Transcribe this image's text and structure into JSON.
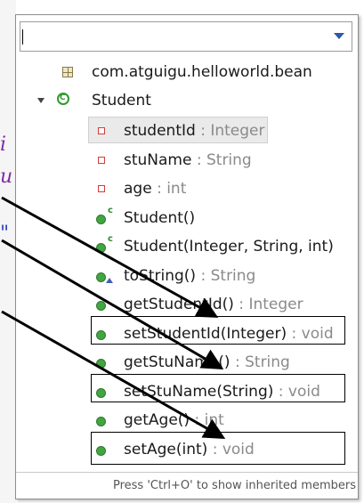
{
  "editor": {
    "fragments": [
      "i",
      "u",
      "\""
    ]
  },
  "outline": {
    "filter_value": "",
    "package": "com.atguigu.helloworld.bean",
    "class_name": "Student",
    "members": [
      {
        "name": "studentId",
        "type": " : Integer",
        "kind": "private-field",
        "selected": true
      },
      {
        "name": "stuName",
        "type": " : String",
        "kind": "private-field"
      },
      {
        "name": "age",
        "type": " : int",
        "kind": "private-field"
      },
      {
        "name": "Student()",
        "type": "",
        "kind": "constructor"
      },
      {
        "name": "Student(Integer, String, int)",
        "type": "",
        "kind": "constructor"
      },
      {
        "name": "toString()",
        "type": " : String",
        "kind": "override-method"
      },
      {
        "name": "getStudentId()",
        "type": " : Integer",
        "kind": "public-method"
      },
      {
        "name": "setStudentId(Integer)",
        "type": " : void",
        "kind": "public-method",
        "highlighted": true
      },
      {
        "name": "getStuName()",
        "type": " : String",
        "kind": "public-method"
      },
      {
        "name": "setStuName(String)",
        "type": " : void",
        "kind": "public-method",
        "highlighted": true
      },
      {
        "name": "getAge()",
        "type": " : int",
        "kind": "public-method"
      },
      {
        "name": "setAge(int)",
        "type": " : void",
        "kind": "public-method",
        "highlighted": true
      }
    ],
    "footer": "Press 'Ctrl+O' to show inherited members"
  },
  "colors": {
    "field_icon": "#d33b3b",
    "method_icon": "#41a541",
    "type_text": "#8a8a8a",
    "dropdown": "#2a5aa8"
  }
}
